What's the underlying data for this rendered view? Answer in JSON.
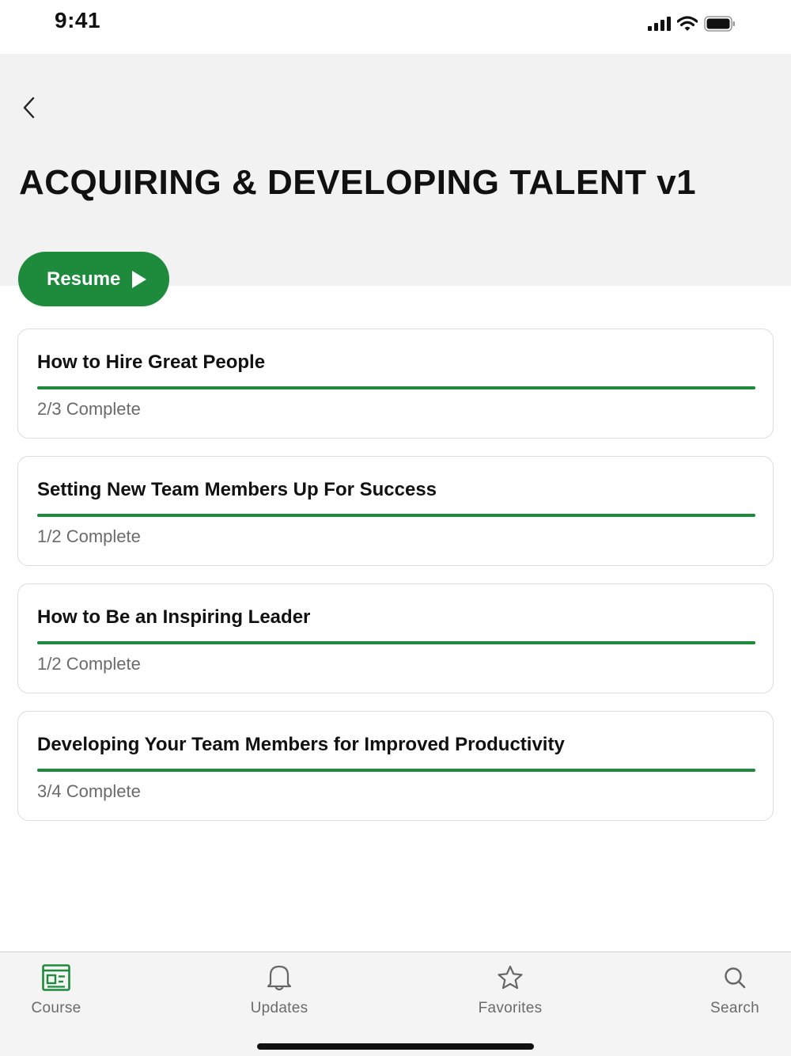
{
  "status_bar": {
    "time": "9:41"
  },
  "header": {
    "title": "ACQUIRING & DEVELOPING TALENT v1"
  },
  "resume_button": {
    "label": "Resume"
  },
  "courses": [
    {
      "title": "How to Hire Great People",
      "status": "2/3 Complete",
      "progress": 1.0
    },
    {
      "title": "Setting New Team Members Up For Success",
      "status": "1/2 Complete",
      "progress": 1.0
    },
    {
      "title": "How to Be an Inspiring Leader",
      "status": "1/2 Complete",
      "progress": 1.0
    },
    {
      "title": "Developing Your Team Members for Improved Productivity",
      "status": "3/4 Complete",
      "progress": 1.0
    }
  ],
  "tab_bar": {
    "tabs": [
      {
        "label": "Course",
        "icon": "course-icon",
        "active": true
      },
      {
        "label": "Updates",
        "icon": "bell-icon",
        "active": false
      },
      {
        "label": "Favorites",
        "icon": "star-icon",
        "active": false
      },
      {
        "label": "Search",
        "icon": "search-icon",
        "active": false
      }
    ]
  },
  "colors": {
    "accent": "#1d8a3c",
    "header_bg": "#f2f2f2",
    "tab_bg": "#f4f4f4"
  }
}
